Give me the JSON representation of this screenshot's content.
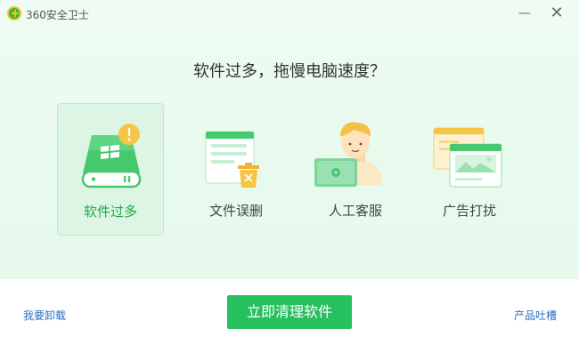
{
  "window": {
    "title": "360安全卫士",
    "minimize_glyph": "—",
    "close_glyph": "✕"
  },
  "heading": "软件过多，拖慢电脑速度？",
  "options": [
    {
      "label": "软件过多",
      "icon": "drive-windows-icon",
      "selected": true
    },
    {
      "label": "文件误删",
      "icon": "document-trash-icon",
      "selected": false
    },
    {
      "label": "人工客服",
      "icon": "support-agent-icon",
      "selected": false
    },
    {
      "label": "广告打扰",
      "icon": "popup-ads-icon",
      "selected": false
    }
  ],
  "footer": {
    "left_link": "我要卸载",
    "primary_button": "立即清理软件",
    "right_link": "产品吐槽"
  },
  "colors": {
    "accent_green": "#27c05e",
    "link_blue": "#2b6ec2",
    "warning_yellow": "#f6c545"
  }
}
